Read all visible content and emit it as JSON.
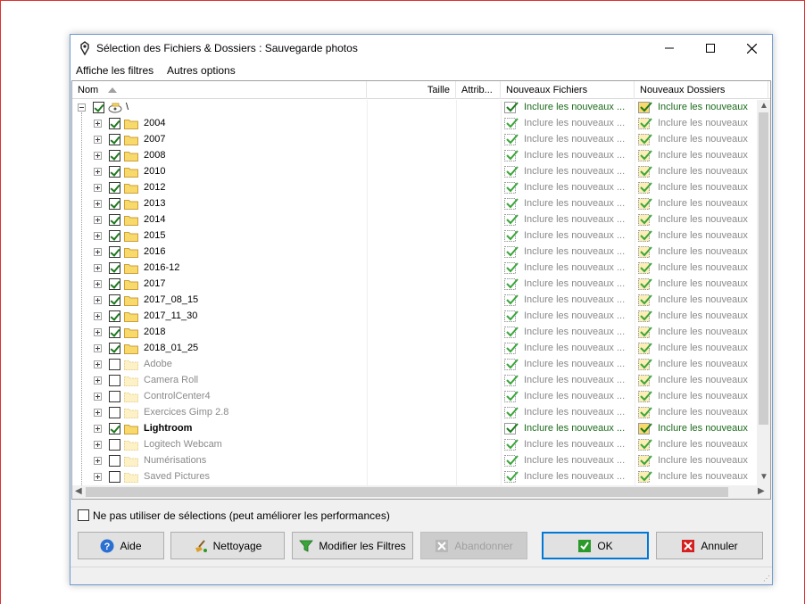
{
  "window": {
    "title": "Sélection des Fichiers & Dossiers : Sauvegarde photos"
  },
  "menu": {
    "items": [
      "Affiche les filtres",
      "Autres options"
    ]
  },
  "columns": {
    "name": "Nom",
    "size": "Taille",
    "attrib": "Attrib...",
    "new_files": "Nouveaux Fichiers",
    "new_folders": "Nouveaux Dossiers"
  },
  "root": {
    "label": "\\",
    "checked": true,
    "new_files": "Inclure les nouveaux ...",
    "new_folders": "Inclure les nouveaux"
  },
  "folders": [
    {
      "name": "2004",
      "checked": true
    },
    {
      "name": "2007",
      "checked": true
    },
    {
      "name": "2008",
      "checked": true
    },
    {
      "name": "2010",
      "checked": true
    },
    {
      "name": "2012",
      "checked": true
    },
    {
      "name": "2013",
      "checked": true
    },
    {
      "name": "2014",
      "checked": true
    },
    {
      "name": "2015",
      "checked": true
    },
    {
      "name": "2016",
      "checked": true
    },
    {
      "name": "2016-12",
      "checked": true
    },
    {
      "name": "2017",
      "checked": true
    },
    {
      "name": "2017_08_15",
      "checked": true
    },
    {
      "name": "2017_11_30",
      "checked": true
    },
    {
      "name": "2018",
      "checked": true
    },
    {
      "name": "2018_01_25",
      "checked": true
    },
    {
      "name": "Adobe",
      "checked": false
    },
    {
      "name": "Camera Roll",
      "checked": false
    },
    {
      "name": "ControlCenter4",
      "checked": false
    },
    {
      "name": "Exercices Gimp 2.8",
      "checked": false
    },
    {
      "name": "Lightroom",
      "checked": true,
      "bold": true,
      "active": true
    },
    {
      "name": "Logitech Webcam",
      "checked": false
    },
    {
      "name": "Numérisations",
      "checked": false
    },
    {
      "name": "Saved Pictures",
      "checked": false
    }
  ],
  "include_text_files": "Inclure les nouveaux ...",
  "include_text_folders": "Inclure les nouveaux",
  "option": {
    "label": "Ne pas utiliser de sélections (peut améliorer les performances)",
    "checked": false
  },
  "buttons": {
    "help": "Aide",
    "cleanup": "Nettoyage",
    "filters": "Modifier les Filtres",
    "abort": "Abandonner",
    "ok": "OK",
    "cancel": "Annuler"
  },
  "colors": {
    "accent": "#0078d7",
    "check": "#1b7a1b",
    "folder": "#f5c842",
    "cancel_red": "#d42020"
  },
  "icons": {
    "title": "app-icon",
    "help": "help-icon",
    "cleanup": "broom-icon",
    "filters": "funnel-icon",
    "abort": "x-icon",
    "ok": "check-icon",
    "cancel": "x-red-icon"
  }
}
